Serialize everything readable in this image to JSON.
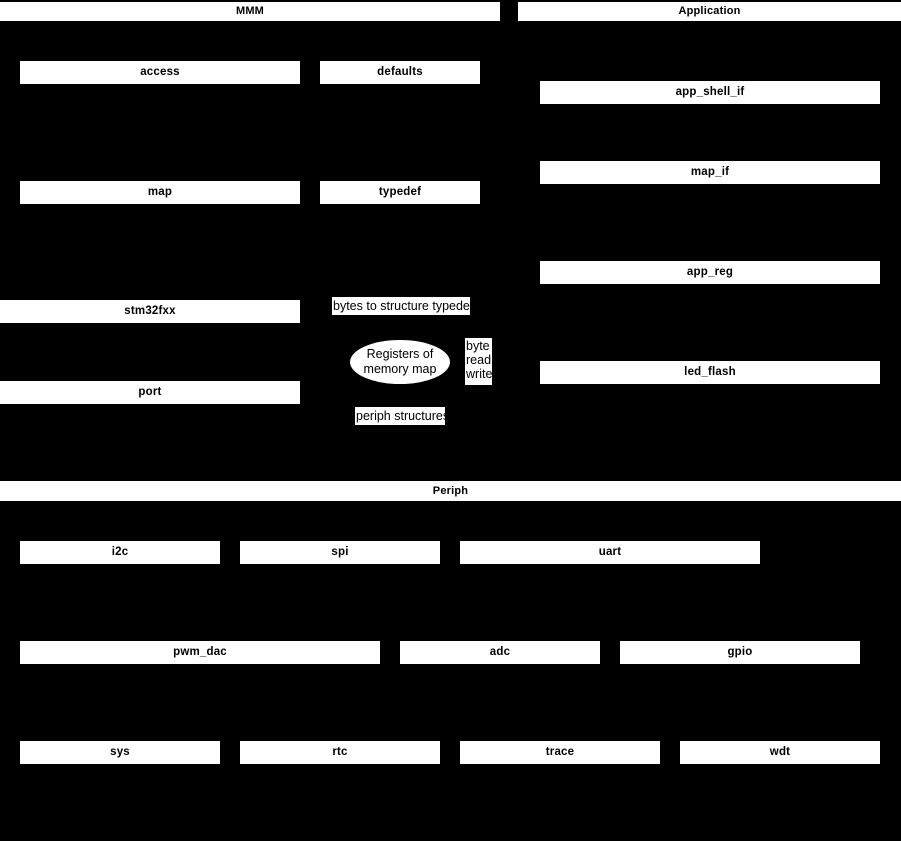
{
  "diagram": {
    "background_color": "#000000",
    "node_color": "#ffffff",
    "text_color": "#000000",
    "groups": [
      {
        "id": "mmm",
        "title": "MMM",
        "modules": [
          {
            "id": "access",
            "label": "access"
          },
          {
            "id": "defaults",
            "label": "defaults"
          },
          {
            "id": "map",
            "label": "map"
          },
          {
            "id": "typedef",
            "label": "typedef"
          },
          {
            "id": "stm32fxx",
            "label": "stm32fxx"
          },
          {
            "id": "port",
            "label": "port"
          }
        ]
      },
      {
        "id": "application",
        "title": "Application",
        "modules": [
          {
            "id": "app_shell_if",
            "label": "app_shell_if"
          },
          {
            "id": "map_if",
            "label": "map_if"
          },
          {
            "id": "app_reg",
            "label": "app_reg"
          },
          {
            "id": "led_flash",
            "label": "led_flash"
          }
        ]
      },
      {
        "id": "periph",
        "title": "Periph",
        "modules": [
          {
            "id": "i2c",
            "label": "i2c"
          },
          {
            "id": "spi",
            "label": "spi"
          },
          {
            "id": "uart",
            "label": "uart"
          },
          {
            "id": "pwm_dac",
            "label": "pwm_dac"
          },
          {
            "id": "adc",
            "label": "adc"
          },
          {
            "id": "gpio",
            "label": "gpio"
          },
          {
            "id": "sys",
            "label": "sys"
          },
          {
            "id": "rtc",
            "label": "rtc"
          },
          {
            "id": "trace",
            "label": "trace"
          },
          {
            "id": "wdt",
            "label": "wdt"
          }
        ]
      }
    ],
    "annotations": {
      "bytes_to_structure_typedef": "bytes to structure typedef",
      "periph_structures": "periph structures",
      "byte_read_write": {
        "line1": "byte",
        "line2": "read",
        "line3": "write"
      }
    },
    "center_node": {
      "id": "registers-of-memory-map",
      "line1": "Registers of",
      "line2": "memory map"
    }
  }
}
